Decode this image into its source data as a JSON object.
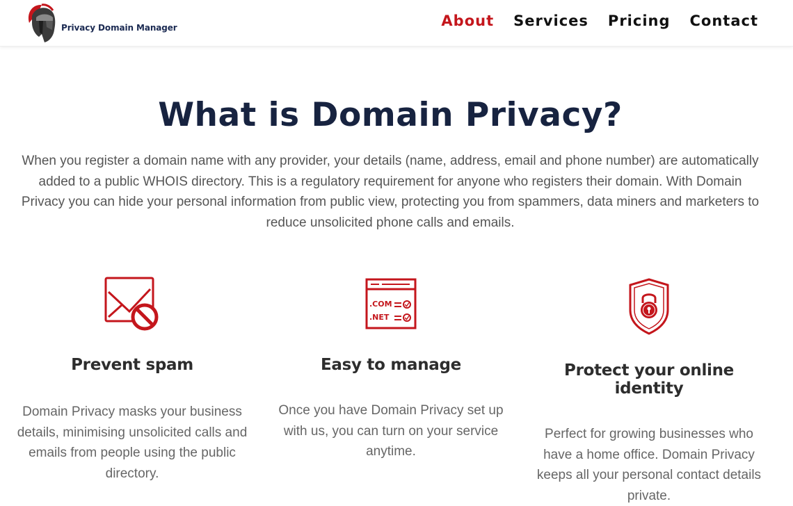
{
  "header": {
    "logo_text": "Privacy Domain Manager",
    "nav": [
      {
        "label": "About",
        "active": true
      },
      {
        "label": "Services",
        "active": false
      },
      {
        "label": "Pricing",
        "active": false
      },
      {
        "label": "Contact",
        "active": false
      }
    ]
  },
  "main": {
    "title": "What is Domain Privacy?",
    "intro": "When you register a domain name with any provider, your details (name, address, email and phone number) are automatically added to a public WHOIS directory. This is a regulatory requirement for anyone who registers their domain. With Domain Privacy you can hide your personal information from public view, protecting you from spammers, data miners and marketers to reduce unsolicited phone calls and emails.",
    "features": [
      {
        "icon": "no-mail-icon",
        "title": "Prevent spam",
        "text": "Domain Privacy masks your business details, minimising unsolicited calls and emails from people using the public directory."
      },
      {
        "icon": "domain-list-icon",
        "title": "Easy to manage",
        "icon_labels": [
          ".COM",
          ".NET"
        ],
        "text": "Once you have Domain Privacy set up with us, you can turn on your service anytime."
      },
      {
        "icon": "shield-lock-icon",
        "title": "Protect your online identity",
        "text": "Perfect for growing businesses who have a home office. Domain Privacy keeps all your personal contact details private."
      }
    ]
  },
  "colors": {
    "accent": "#c4161c",
    "title": "#172340",
    "body_text": "#555555",
    "brand_text": "#1b2a52"
  }
}
